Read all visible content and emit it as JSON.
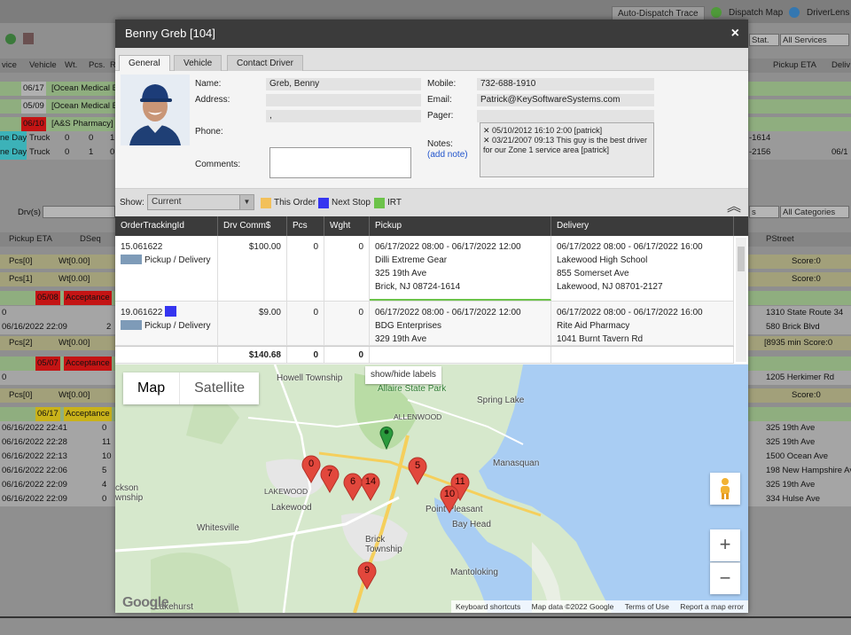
{
  "background_app": {
    "top_buttons": [
      "Auto-Dispatch Trace",
      "Dispatch Map",
      "DriverLens"
    ],
    "top_filters": [
      "Stat.",
      "All Services"
    ],
    "order_headers": [
      "vice",
      "Vehicle",
      "Wt.",
      "Pcs.",
      "R"
    ],
    "pickup_eta_header": "Pickup ETA",
    "deliv_header": "Deliv",
    "order_rows": [
      {
        "date": "06/17",
        "text": "[Ocean Medical B"
      },
      {
        "date": "05/09",
        "text": "[Ocean Medical B"
      },
      {
        "date": "06/10",
        "text": "[A&S Pharmacy]"
      },
      {
        "svc": "ne Day",
        "vehicle": "Truck",
        "wt": "0",
        "pcs": "0",
        "r": "1",
        "right": "-1614"
      },
      {
        "svc": "ne Day",
        "vehicle": "Truck",
        "wt": "0",
        "pcs": "1",
        "r": "0",
        "right": "-2156",
        "right2": "06/1"
      }
    ],
    "drv_label": "Drv(s)",
    "lower_filters": [
      "s",
      "All Categories"
    ],
    "lower_headers": [
      "Pickup ETA",
      "DSeq",
      "PStreet"
    ],
    "lower_rows": [
      {
        "left": "Pcs[0]",
        "mid": "Wt[0.00]",
        "right": "Score:0"
      },
      {
        "left": "Pcs[1]",
        "mid": "Wt[0.00]",
        "right": "Score:0"
      },
      {
        "tag": "05/08",
        "status": "Acceptance"
      },
      {
        "left": "0",
        "right": "1310 State Route 34"
      },
      {
        "left": "06/16/2022 22:09",
        "mid": "2",
        "right": "580 Brick Blvd"
      },
      {
        "left": "Pcs[2]",
        "mid": "Wt[0.00]",
        "right": "[8935 min Score:0"
      },
      {
        "tag": "05/07",
        "status": "Acceptance"
      },
      {
        "left": "0",
        "right": "1205 Herkimer Rd"
      },
      {
        "left": "Pcs[0]",
        "mid": "Wt[0.00]",
        "right": "Score:0"
      },
      {
        "tag": "06/17",
        "status": "Acceptance"
      },
      {
        "left": "06/16/2022 22:41",
        "mid": "0",
        "right": "325 19th Ave"
      },
      {
        "left": "06/16/2022 22:28",
        "mid": "11",
        "right": "325 19th Ave"
      },
      {
        "left": "06/16/2022 22:13",
        "mid": "10",
        "right": "1500 Ocean Ave"
      },
      {
        "left": "06/16/2022 22:06",
        "mid": "5",
        "right": "198 New Hampshire Ave"
      },
      {
        "left": "06/16/2022 22:09",
        "mid": "4",
        "right": "325 19th Ave"
      },
      {
        "left": "06/16/2022 22:09",
        "mid": "0",
        "right": "334 Hulse Ave"
      }
    ]
  },
  "dialog": {
    "title": "Benny Greb [104]",
    "close": "×",
    "tabs": [
      "General",
      "Vehicle",
      "Contact Driver"
    ],
    "general": {
      "name_label": "Name:",
      "name": "Greb, Benny",
      "address_label": "Address:",
      "address_line1": "",
      "address_line2": ",",
      "phone_label": "Phone:",
      "comments_label": "Comments:",
      "comments": "",
      "mobile_label": "Mobile:",
      "mobile": "732-688-1910",
      "email_label": "Email:",
      "email": "Patrick@KeySoftwareSystems.com",
      "pager_label": "Pager:",
      "pager": "",
      "notes_label": "Notes:",
      "add_note": "(add note)",
      "notes": [
        "05/10/2012 16:10  2:00 [patrick]",
        "03/21/2007 09:13  This guy is the best driver for our Zone 1 service area [patrick]"
      ]
    },
    "show": {
      "label": "Show:",
      "selected": "Current",
      "legend": [
        {
          "label": "This Order",
          "color": "#f2c05a"
        },
        {
          "label": "Next Stop",
          "color": "#3535f0"
        },
        {
          "label": "IRT",
          "color": "#6cc34a"
        }
      ],
      "collapse": "︽"
    },
    "table": {
      "headers": [
        "OrderTrackingId",
        "Drv Comm$",
        "Pcs",
        "Wght",
        "Pickup",
        "Delivery"
      ],
      "rows": [
        {
          "id": "15.061622",
          "kind": "Pickup / Delivery",
          "comm": "$100.00",
          "pcs": "0",
          "wght": "0",
          "pickup": [
            "06/17/2022 08:00 - 06/17/2022 12:00",
            "Dilli Extreme Gear",
            "325 19th Ave",
            "Brick, NJ 08724-1614"
          ],
          "delivery": [
            "06/17/2022 08:00 - 06/17/2022 16:00",
            "Lakewood High School",
            "855 Somerset Ave",
            "Lakewood, NJ 08701-2127"
          ]
        },
        {
          "id": "19.061622",
          "kind": "Pickup / Delivery",
          "comm": "$9.00",
          "pcs": "0",
          "wght": "0",
          "pickup": [
            "06/17/2022 08:00 - 06/17/2022 12:00",
            "BDG Enterprises",
            "329 19th Ave"
          ],
          "delivery": [
            "06/17/2022 08:00 - 06/17/2022 16:00",
            "Rite Aid Pharmacy",
            "1041 Burnt Tavern Rd"
          ]
        }
      ],
      "totals": {
        "comm": "$140.68",
        "pcs": "0",
        "wght": "0"
      }
    },
    "map": {
      "types": [
        "Map",
        "Satellite"
      ],
      "labels_button": "show/hide labels",
      "places": [
        "Howell Township",
        "Allaire State Park",
        "ALLENWOOD",
        "Spring Lake",
        "Manasquan",
        "LAKEWOOD",
        "Lakewood",
        "Point Pleasant",
        "Bay Head",
        "Whitesville",
        "Brick Township",
        "Mantoloking",
        "Lakehurst",
        "ckson wnship"
      ],
      "markers": [
        "0",
        "7",
        "6",
        "14",
        "5",
        "11",
        "10",
        "9"
      ],
      "zoom_in": "+",
      "zoom_out": "−",
      "logo": "Google",
      "attribution": [
        "Keyboard shortcuts",
        "Map data ©2022 Google",
        "Terms of Use",
        "Report a map error"
      ],
      "colors": {
        "water": "#a9cdf3",
        "land": "#d6e8cc",
        "marker": "#e2473c",
        "green_marker": "#2a9a3c"
      }
    }
  }
}
